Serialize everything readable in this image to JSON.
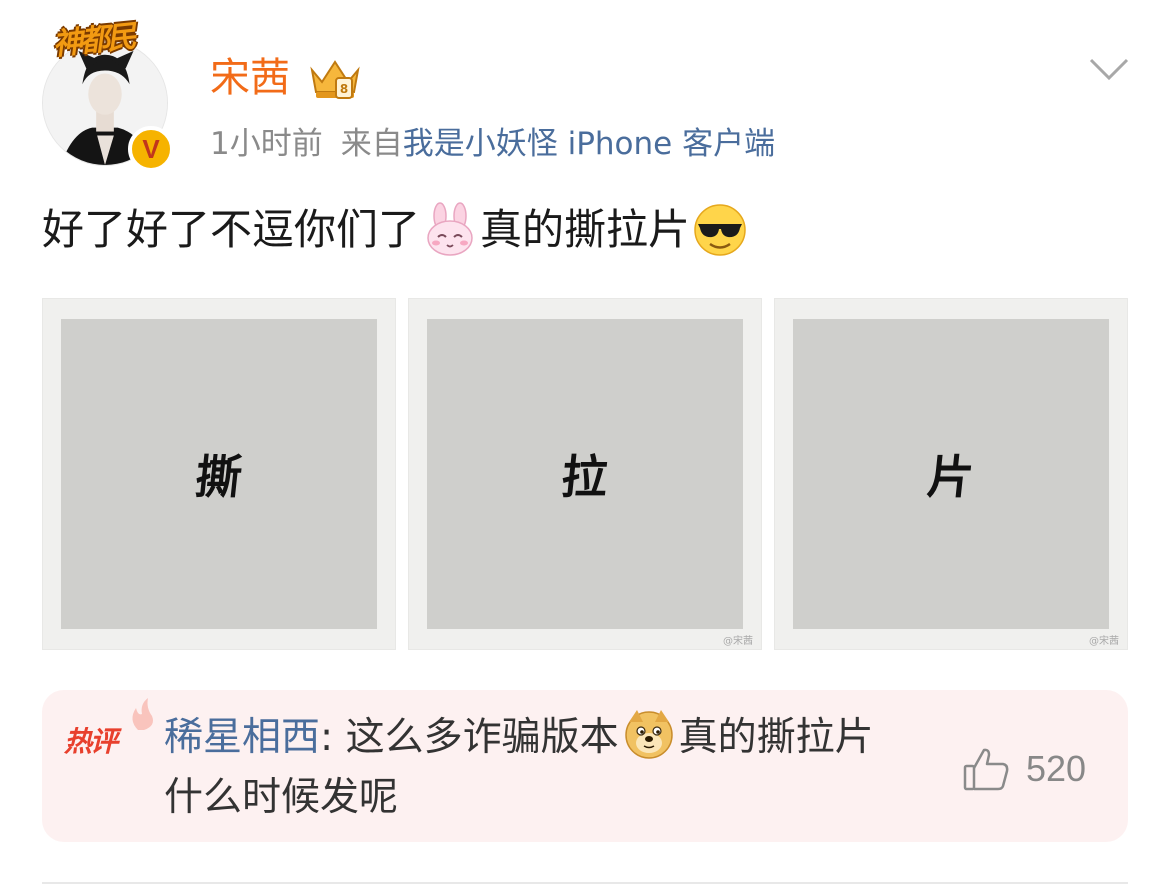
{
  "header": {
    "badge_text": "神都民",
    "username": "宋茜",
    "verified_mark": "V",
    "time": "1小时前",
    "from_label": "来自",
    "device": "我是小妖怪 iPhone 客户端"
  },
  "post": {
    "text_part1": "好了好了不逗你们了",
    "emoji1": "bunny-emoji",
    "text_part2": "真的撕拉片",
    "emoji2": "sunglasses-emoji",
    "photos": [
      {
        "glyph": "撕",
        "watermark": ""
      },
      {
        "glyph": "拉",
        "watermark": "@宋茜"
      },
      {
        "glyph": "片",
        "watermark": "@宋茜"
      }
    ]
  },
  "hot_comment": {
    "tag": "热评",
    "author": "稀星相西",
    "separator": ": ",
    "text_part1": "这么多诈骗版本",
    "emoji": "doge-emoji",
    "text_part2": "真的撕拉片什么时候发呢",
    "like_count": "520"
  },
  "colors": {
    "username": "#f26b18",
    "link": "#4a6d9c",
    "hot_tag": "#e8402d",
    "comment_bg": "#fdf1f1"
  }
}
